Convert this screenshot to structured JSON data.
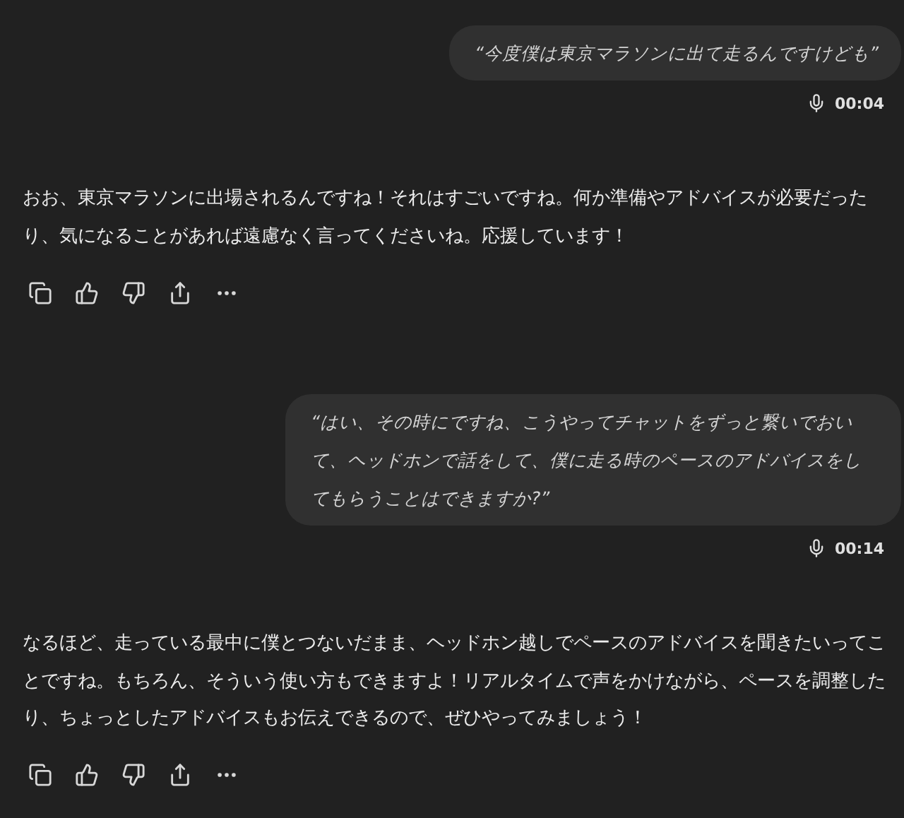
{
  "messages": [
    {
      "kind": "user",
      "text": "“今度僕は東京マラソンに出て走るんですけども”",
      "duration": "00:04"
    },
    {
      "kind": "assistant",
      "text": "おお、東京マラソンに出場されるんですね！それはすごいですね。何か準備やアドバイスが必要だったり、気になることがあれば遠慮なく言ってくださいね。応援しています！"
    },
    {
      "kind": "user",
      "text": "“はい、その時にですね、こうやってチャットをずっと繋いでおいて、ヘッドホンで話をして、僕に走る時のペースのアドバイスをしてもらうことはできますか?”",
      "duration": "00:14"
    },
    {
      "kind": "assistant",
      "text": "なるほど、走っている最中に僕とつないだまま、ヘッドホン越しでペースのアドバイスを聞きたいってことですね。もちろん、そういう使い方もできますよ！リアルタイムで声をかけながら、ペースを調整したり、ちょっとしたアドバイスもお伝えできるので、ぜひやってみましょう！"
    }
  ]
}
